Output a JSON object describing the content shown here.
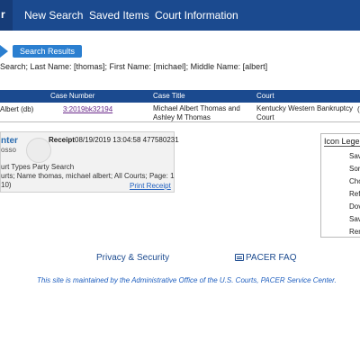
{
  "nav": {
    "brand_fragment": "r",
    "items": [
      "New Search",
      "Saved Items",
      "Court Information"
    ]
  },
  "breadcrumb": {
    "label": "Search Results"
  },
  "criteria": "Search; Last Name: [thomas]; First Name: [michael]; Middle Name: [albert]",
  "table": {
    "headers": [
      "Case Number",
      "Case Title",
      "Court"
    ],
    "rows": [
      {
        "party": "Albert (db)",
        "case_number": "3:2019bk32194",
        "case_title": "Michael Albert Thomas and Ashley M Thomas",
        "court": "Kentucky Western Bankruptcy Court",
        "edge": "("
      }
    ]
  },
  "receipt": {
    "title_fragment": "nter",
    "receipt_label": "Receipt",
    "timestamp": "08/19/2019 13:04:58 477580231",
    "line2": "osso",
    "line3": "urt Types Party Search",
    "line4": "urts; Name thomas, michael albert; All Courts; Page: 1",
    "line5": "10)",
    "print_link": "Print Receipt"
  },
  "legend": {
    "title": "Icon Legend",
    "items": [
      "Sav",
      "Sor",
      "Cho",
      "Refi",
      "Dov",
      "Sav",
      "Ren"
    ]
  },
  "footer": {
    "privacy": "Privacy & Security",
    "faq": "PACER FAQ",
    "maintained": "This site is maintained by the Administrative Office of the U.S. Courts, PACER Service Center."
  }
}
